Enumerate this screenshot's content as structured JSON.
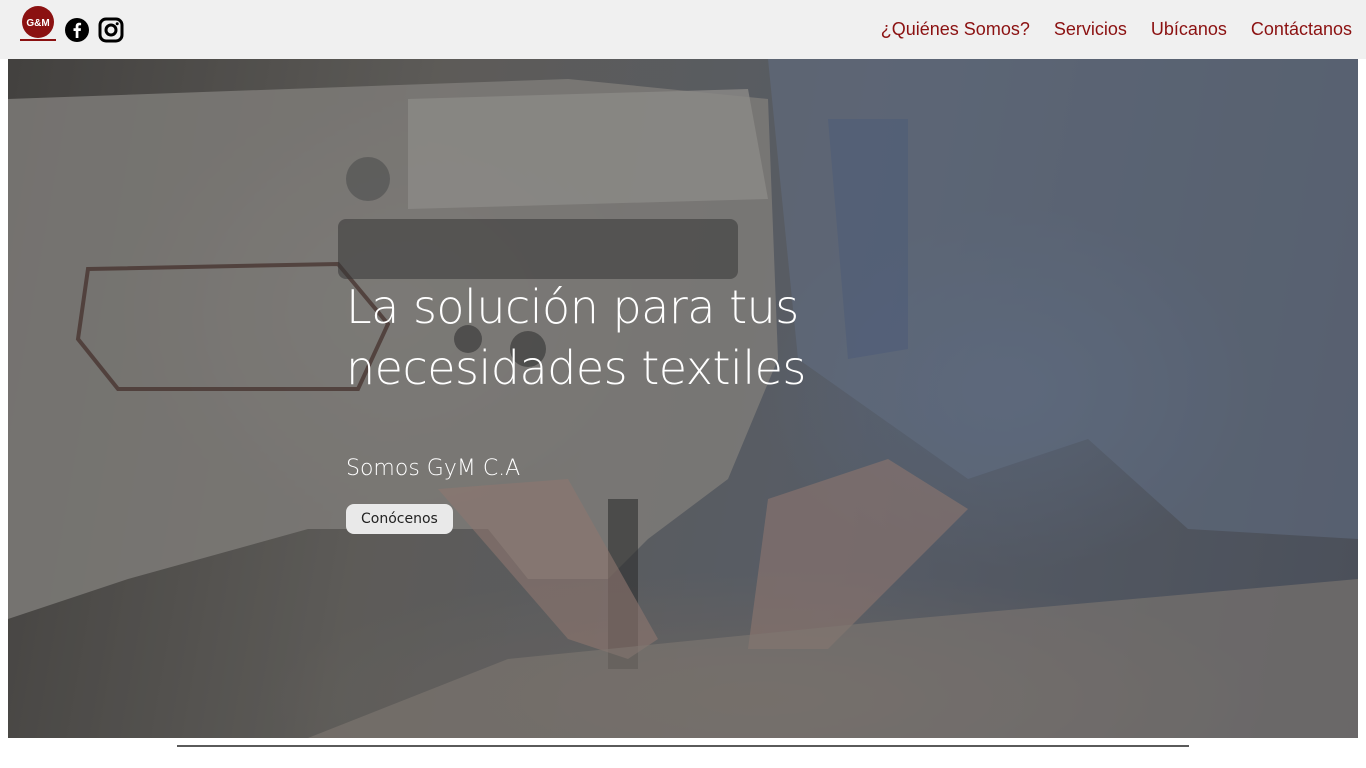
{
  "header": {
    "logo_text": "G&M",
    "social": [
      {
        "name": "facebook",
        "icon": "facebook-icon"
      },
      {
        "name": "instagram",
        "icon": "instagram-icon"
      }
    ],
    "nav": [
      {
        "label": "¿Quiénes Somos?"
      },
      {
        "label": "Servicios"
      },
      {
        "label": "Ubícanos"
      },
      {
        "label": "Contáctanos"
      }
    ]
  },
  "hero": {
    "title": "La solución para tus necesidades textiles",
    "subtitle": "Somos GyM C.A",
    "button_label": "Conócenos",
    "image": "sewing-machine-photo"
  },
  "colors": {
    "nav_bg": "#f0f0f0",
    "nav_link": "#8b1111",
    "logo": "#8b1111"
  }
}
